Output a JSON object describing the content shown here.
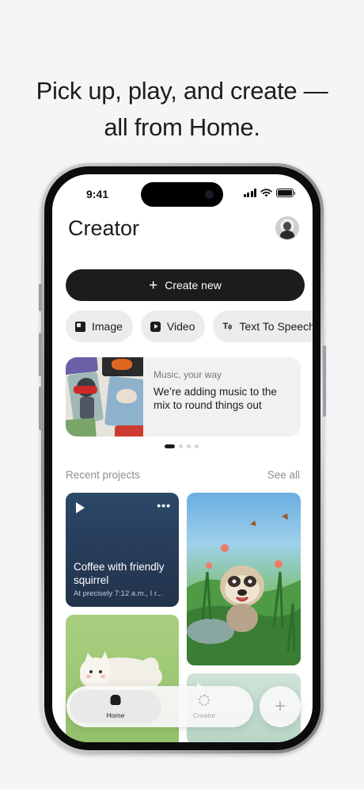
{
  "headline": {
    "line1": "Pick up, play, and create —",
    "line2": "all from Home."
  },
  "status_bar": {
    "time": "9:41"
  },
  "app": {
    "title": "Creator",
    "create_button": {
      "icon": "plus-icon",
      "label": "Create new"
    },
    "chips": [
      {
        "icon": "image-icon",
        "label": "Image"
      },
      {
        "icon": "video-icon",
        "label": "Video"
      },
      {
        "icon": "text-to-speech-icon",
        "label": "Text To Speech"
      }
    ],
    "promo": {
      "kicker": "Music, your way",
      "text": "We’re adding music to the mix to round things out"
    },
    "carousel": {
      "pages": 4,
      "active_index": 0
    },
    "recent": {
      "title": "Recent projects",
      "see_all": "See all",
      "projects": [
        {
          "title": "Coffee with friendly squirrel",
          "subtitle": "At precisely 7:12 a.m., I r..."
        }
      ]
    },
    "tabbar": {
      "tabs": [
        {
          "icon": "home-icon",
          "label": "Home",
          "active": true
        },
        {
          "icon": "creator-icon",
          "label": "Creator",
          "active": false
        }
      ],
      "fab_icon": "plus-icon"
    }
  },
  "colors": {
    "background": "#f5f5f7",
    "primary_button": "#1c1c1e",
    "chip": "#ececee",
    "muted_text": "#8e8e93"
  }
}
